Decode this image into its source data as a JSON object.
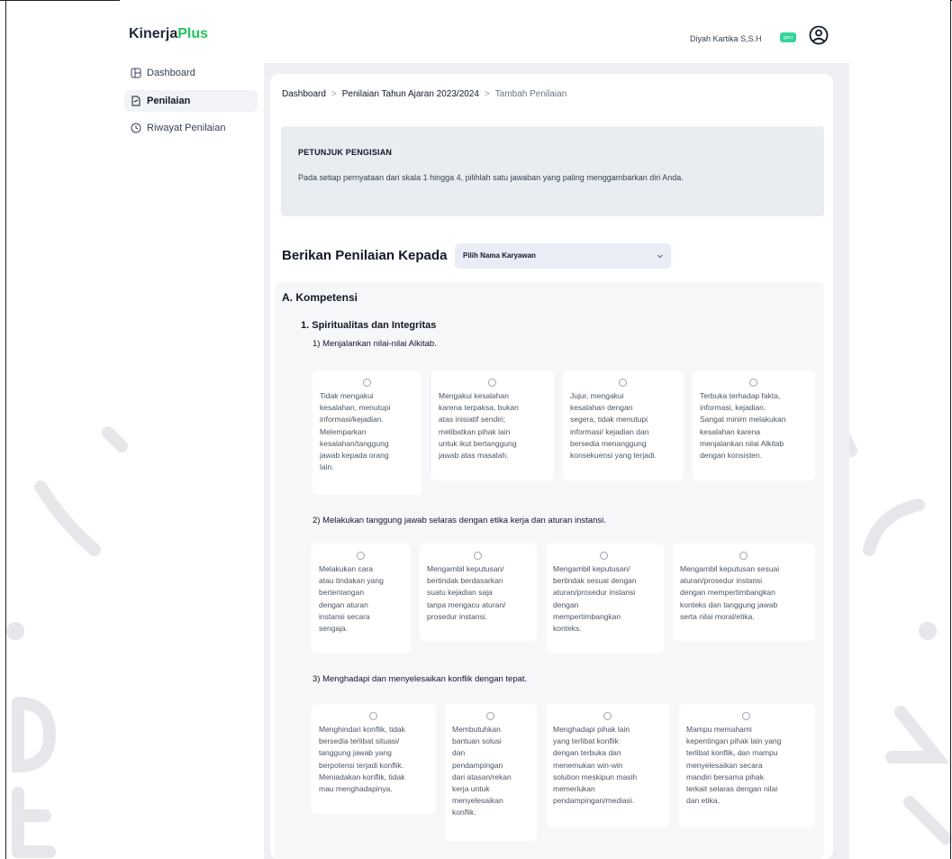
{
  "app": {
    "logo_main": "Kinerja",
    "logo_accent": "Plus"
  },
  "sidebar": {
    "items": [
      {
        "label": "Dashboard",
        "icon": "dashboard-icon",
        "active": false
      },
      {
        "label": "Penilaian",
        "icon": "document-icon",
        "active": true
      },
      {
        "label": "Riwayat Penilaian",
        "icon": "history-icon",
        "active": false
      }
    ]
  },
  "header": {
    "user_name": "Diyah Kartika S,S.H",
    "role_badge": "guru",
    "avatar_icon": "user-circle-icon"
  },
  "breadcrumb": {
    "items": [
      "Dashboard",
      "Penilaian Tahun Ajaran 2023/2024",
      "Tambah Penilaian"
    ]
  },
  "instructions": {
    "title": "PETUNJUK PENGISIAN",
    "text": "Pada setiap pernyataan dari skala 1 hingga 4, pilihlah satu jawaban yang paling menggambarkan diri Anda."
  },
  "assessment": {
    "label": "Berikan Penilaian Kepada",
    "select_value": "Pilih Nama Karyawan",
    "section_title": "A. Kompetensi",
    "subsection_title": "1. Spiritualitas dan Integritas",
    "questions": [
      {
        "title": "1) Menjalankan nilai-nilai Alkitab.",
        "options": [
          [
            "Tidak mengakui",
            "kesalahan, menutupi",
            "informasi/kejadian.",
            "Melemparkan",
            "kesalahan/tanggung",
            "jawab kepada orang",
            "lain."
          ],
          [
            "Mengakui kesalahan",
            "karena terpaksa, bukan",
            "atas inisiatif sendiri;",
            "melibatkan pihak lain",
            "untuk ikut bertanggung",
            "jawab atas masalah."
          ],
          [
            "Jujur, mengakui",
            "kesalahan dengan",
            "segera, tidak menutupi",
            "informasi/ kejadian dan",
            "bersedia menanggung",
            "konsekuensi yang terjadi."
          ],
          [
            "Terbuka terhadap fakta,",
            "informasi, kejadian.",
            "Sangat minim melakukan",
            "kesalahan karena",
            "menjalankan nilai Alkitab",
            "dengan konsisten."
          ]
        ]
      },
      {
        "title": "2) Melakukan tanggung jawab selaras dengan etika kerja dan aturan instansi.",
        "options": [
          [
            "Melakukan cara",
            "atau tindakan yang",
            "bertentangan",
            "dengan aturan",
            "instansi secara",
            "sengaja."
          ],
          [
            "Mengambil keputusan/",
            "bertindak berdasarkan",
            "suatu kejadian saja",
            "tanpa mengacu aturan/",
            "prosedur instansi."
          ],
          [
            "Mengambil keputusan/",
            "bertindak sesuai dengan",
            "aturan/prosedur instansi",
            "dengan",
            "mempertimbangkan",
            "konteks."
          ],
          [
            "Mengambil keputusan sesuai",
            "aturan/prosedur instansi",
            "dengan mempertimbangkan",
            "konteks dan tanggung jawab",
            "serta nilai moral/etika."
          ]
        ]
      },
      {
        "title": "3) Menghadapi dan menyelesaikan konflik dengan tepat.",
        "options": [
          [
            "Menghindari konflik, tidak",
            "bersedia terlibat situasi/",
            "tanggung jawab yang",
            "berpotensi terjadi konflik.",
            "Meniadakan konflik, tidak",
            "mau menghadapinya."
          ],
          [
            "Membutuhkan",
            "bantuan solusi",
            "dan",
            "pendampingan",
            "dari atasan/rekan",
            "kerja untuk",
            "menyelesaikan",
            "konflik."
          ],
          [
            "Menghadapi pihak lain",
            "yang terlibat konflik",
            "dengan terbuka dan",
            "menemukan win-win",
            "solution meskipun masih",
            "memerlukan",
            "pendampingan/mediasi."
          ],
          [
            "Mampu memahami",
            "kepentingan pihak lain yang",
            "terlibat konflik, dan mampu",
            "menyelesaikan secara",
            "mandiri bersama pihak",
            "terkait selaras dengan nilai",
            "dan etika."
          ]
        ]
      }
    ]
  },
  "colors": {
    "accent": "#22c55e",
    "badge": "#34d399",
    "panel": "#e9edf2"
  }
}
